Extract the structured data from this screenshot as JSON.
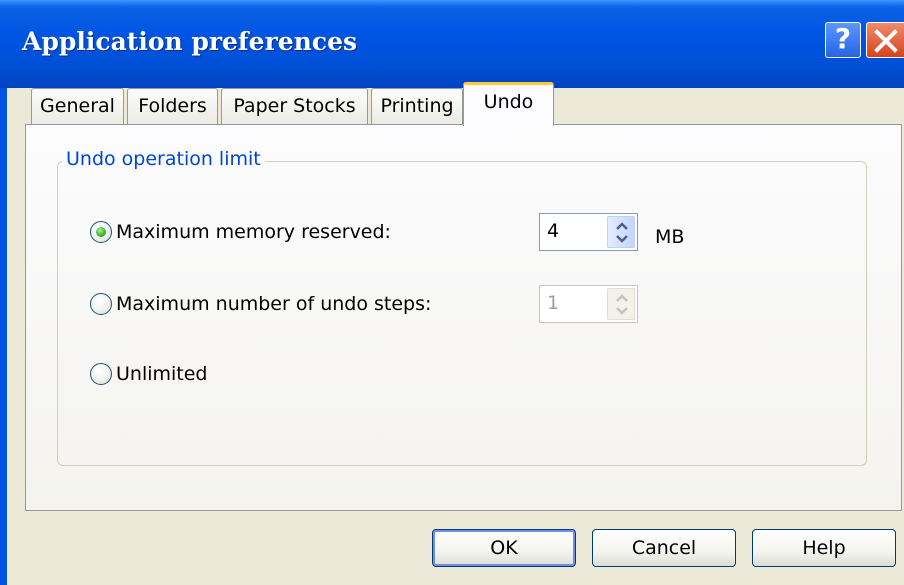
{
  "window": {
    "title": "Application preferences",
    "help_label": "?",
    "accent_color": "#0054e3",
    "close_color": "#d8421c"
  },
  "tabs": [
    {
      "label": "General",
      "active": false
    },
    {
      "label": "Folders",
      "active": false
    },
    {
      "label": "Paper Stocks",
      "active": false
    },
    {
      "label": "Printing",
      "active": false
    },
    {
      "label": "Undo",
      "active": true
    }
  ],
  "group": {
    "legend": "Undo operation limit",
    "options": [
      {
        "label": "Maximum memory reserved:",
        "checked": true
      },
      {
        "label": "Maximum number of undo steps:",
        "checked": false
      },
      {
        "label": "Unlimited",
        "checked": false
      }
    ],
    "memory_value": "4",
    "memory_unit": "MB",
    "steps_value": "1",
    "steps_enabled": false
  },
  "buttons": {
    "ok": "OK",
    "cancel": "Cancel",
    "help": "Help"
  },
  "icons": {
    "help": "help-icon",
    "close": "close-icon",
    "spin_up": "chevron-up-icon",
    "spin_down": "chevron-down-icon"
  }
}
